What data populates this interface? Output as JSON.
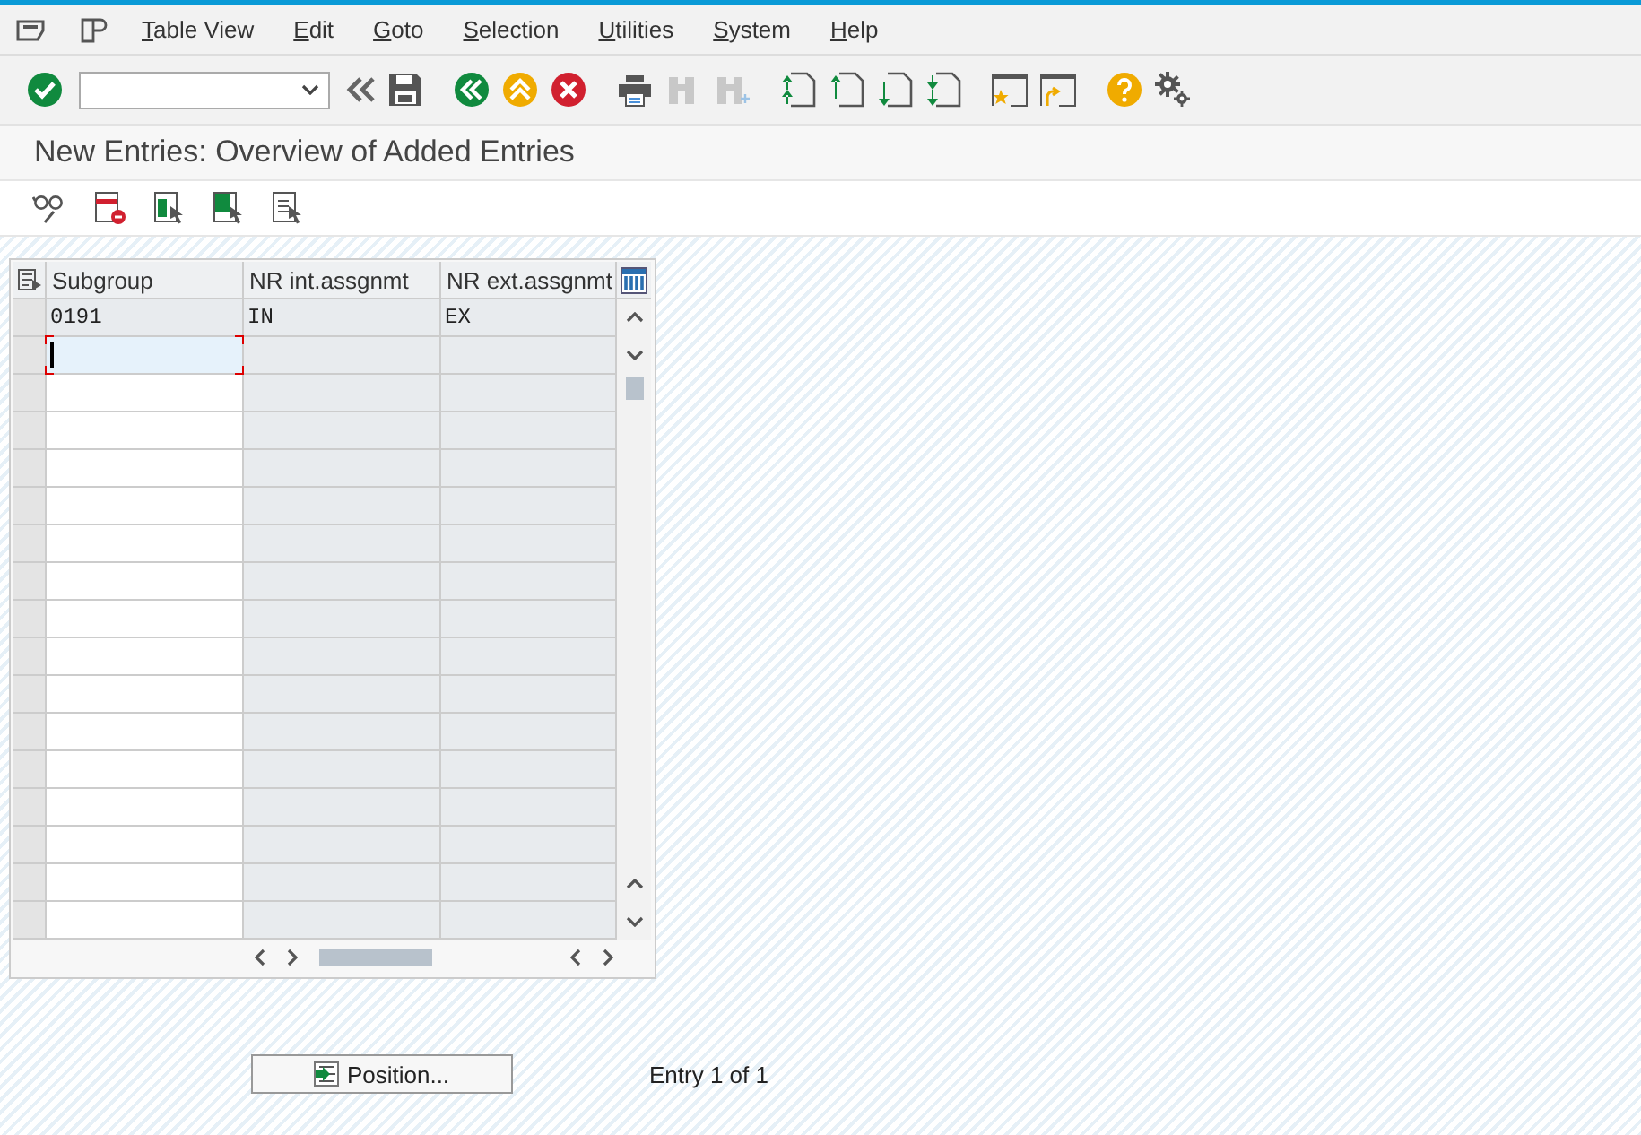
{
  "menu": [
    "Table View",
    "Edit",
    "Goto",
    "Selection",
    "Utilities",
    "System",
    "Help"
  ],
  "toolbar": [
    {
      "kind": "enter",
      "disabled": false
    },
    {
      "kind": "command",
      "disabled": false
    },
    {
      "kind": "collapse",
      "disabled": false
    },
    {
      "kind": "save",
      "disabled": false
    },
    {
      "kind": "back",
      "disabled": false
    },
    {
      "kind": "exit",
      "disabled": false
    },
    {
      "kind": "cancel",
      "disabled": false
    },
    {
      "kind": "print",
      "disabled": false
    },
    {
      "kind": "find",
      "disabled": true
    },
    {
      "kind": "find-next",
      "disabled": true
    },
    {
      "kind": "first-page",
      "disabled": false
    },
    {
      "kind": "prev-page",
      "disabled": false
    },
    {
      "kind": "next-page",
      "disabled": false
    },
    {
      "kind": "last-page",
      "disabled": false
    },
    {
      "kind": "favorite",
      "disabled": false
    },
    {
      "kind": "shortcut",
      "disabled": false
    },
    {
      "kind": "help",
      "disabled": false
    },
    {
      "kind": "settings",
      "disabled": false
    }
  ],
  "title": "New Entries: Overview of Added Entries",
  "app_toolbar": [
    {
      "kind": "display"
    },
    {
      "kind": "delete"
    },
    {
      "kind": "select-all"
    },
    {
      "kind": "select-block"
    },
    {
      "kind": "deselect-all"
    }
  ],
  "table": {
    "columns": [
      "Subgroup",
      "NR int.assgnmt",
      "NR ext.assgnmt"
    ],
    "rows": [
      {
        "kind": "existing",
        "focused": false,
        "cells": [
          "0191",
          "IN",
          "EX"
        ]
      },
      {
        "kind": "new",
        "focused": true
      },
      {
        "kind": "new",
        "focused": false
      },
      {
        "kind": "new",
        "focused": false
      },
      {
        "kind": "new",
        "focused": false
      },
      {
        "kind": "new",
        "focused": false
      },
      {
        "kind": "new",
        "focused": false
      },
      {
        "kind": "new",
        "focused": false
      },
      {
        "kind": "new",
        "focused": false
      },
      {
        "kind": "new",
        "focused": false
      },
      {
        "kind": "new",
        "focused": false
      },
      {
        "kind": "new",
        "focused": false
      },
      {
        "kind": "new",
        "focused": false
      },
      {
        "kind": "new",
        "focused": false
      },
      {
        "kind": "new",
        "focused": false
      },
      {
        "kind": "new",
        "focused": false
      },
      {
        "kind": "new",
        "focused": false
      }
    ]
  },
  "position_button": "Position...",
  "entry_status": "Entry 1 of 1"
}
